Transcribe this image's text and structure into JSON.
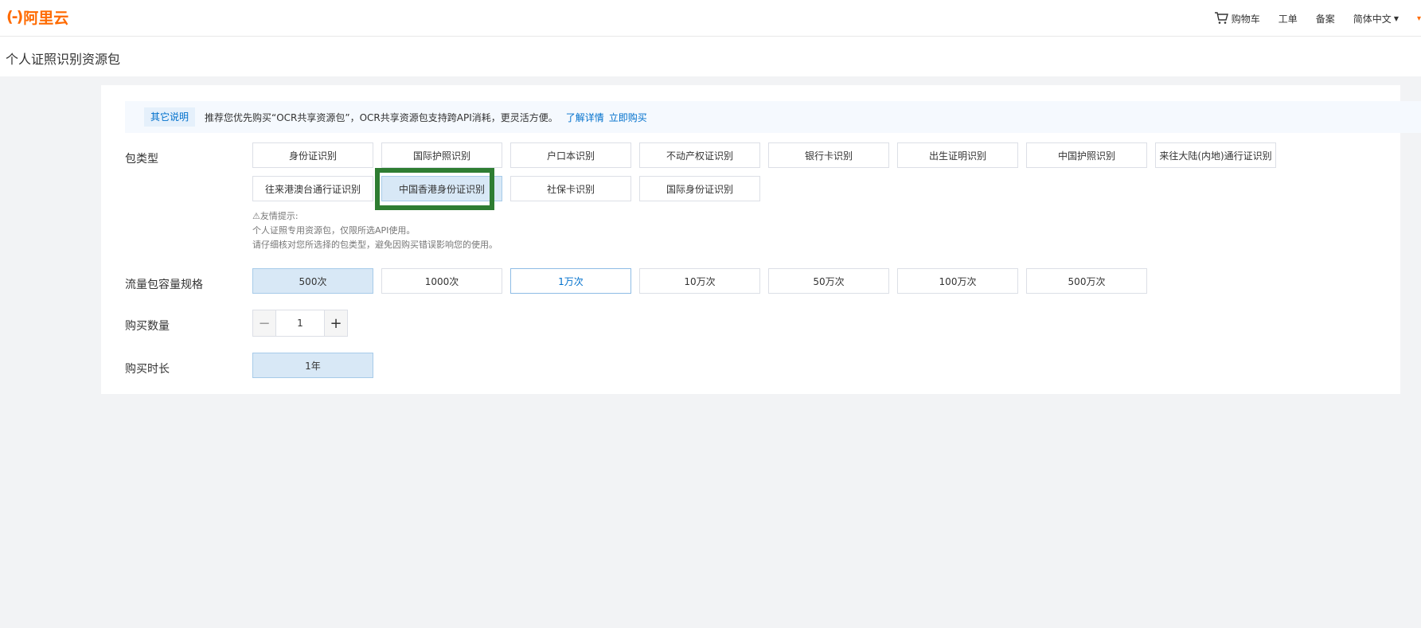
{
  "header": {
    "logo_mark": "(-)",
    "logo_text": "阿里云",
    "nav": {
      "cart": "购物车",
      "ticket": "工单",
      "filing": "备案",
      "language": "简体中文"
    }
  },
  "page_title": "个人证照识别资源包",
  "notice": {
    "tag": "其它说明",
    "text": "推荐您优先购买“OCR共享资源包”，OCR共享资源包支持跨API消耗，更灵活方便。",
    "link_details": "了解详情",
    "link_buy": "立即购买"
  },
  "package_type": {
    "label": "包类型",
    "options": [
      "身份证识别",
      "国际护照识别",
      "户口本识别",
      "不动产权证识别",
      "银行卡识别",
      "出生证明识别",
      "中国护照识别",
      "来往大陆(内地)通行证识别",
      "往来港澳台通行证识别",
      "中国香港身份证识别",
      "社保卡识别",
      "国际身份证识别"
    ],
    "selected": "中国香港身份证识别"
  },
  "tips": {
    "title": "⚠友情提示:",
    "line1": "个人证照专用资源包，仅限所选API使用。",
    "line2": "请仔细核对您所选择的包类型，避免因购买错误影响您的使用。"
  },
  "capacity": {
    "label": "流量包容量规格",
    "options": [
      "500次",
      "1000次",
      "1万次",
      "10万次",
      "50万次",
      "100万次",
      "500万次"
    ],
    "selected": "500次",
    "hovered": "1万次"
  },
  "quantity": {
    "label": "购买数量",
    "minus": "−",
    "value": "1",
    "plus": "+"
  },
  "duration": {
    "label": "购买时长",
    "options": [
      "1年"
    ],
    "selected": "1年"
  }
}
